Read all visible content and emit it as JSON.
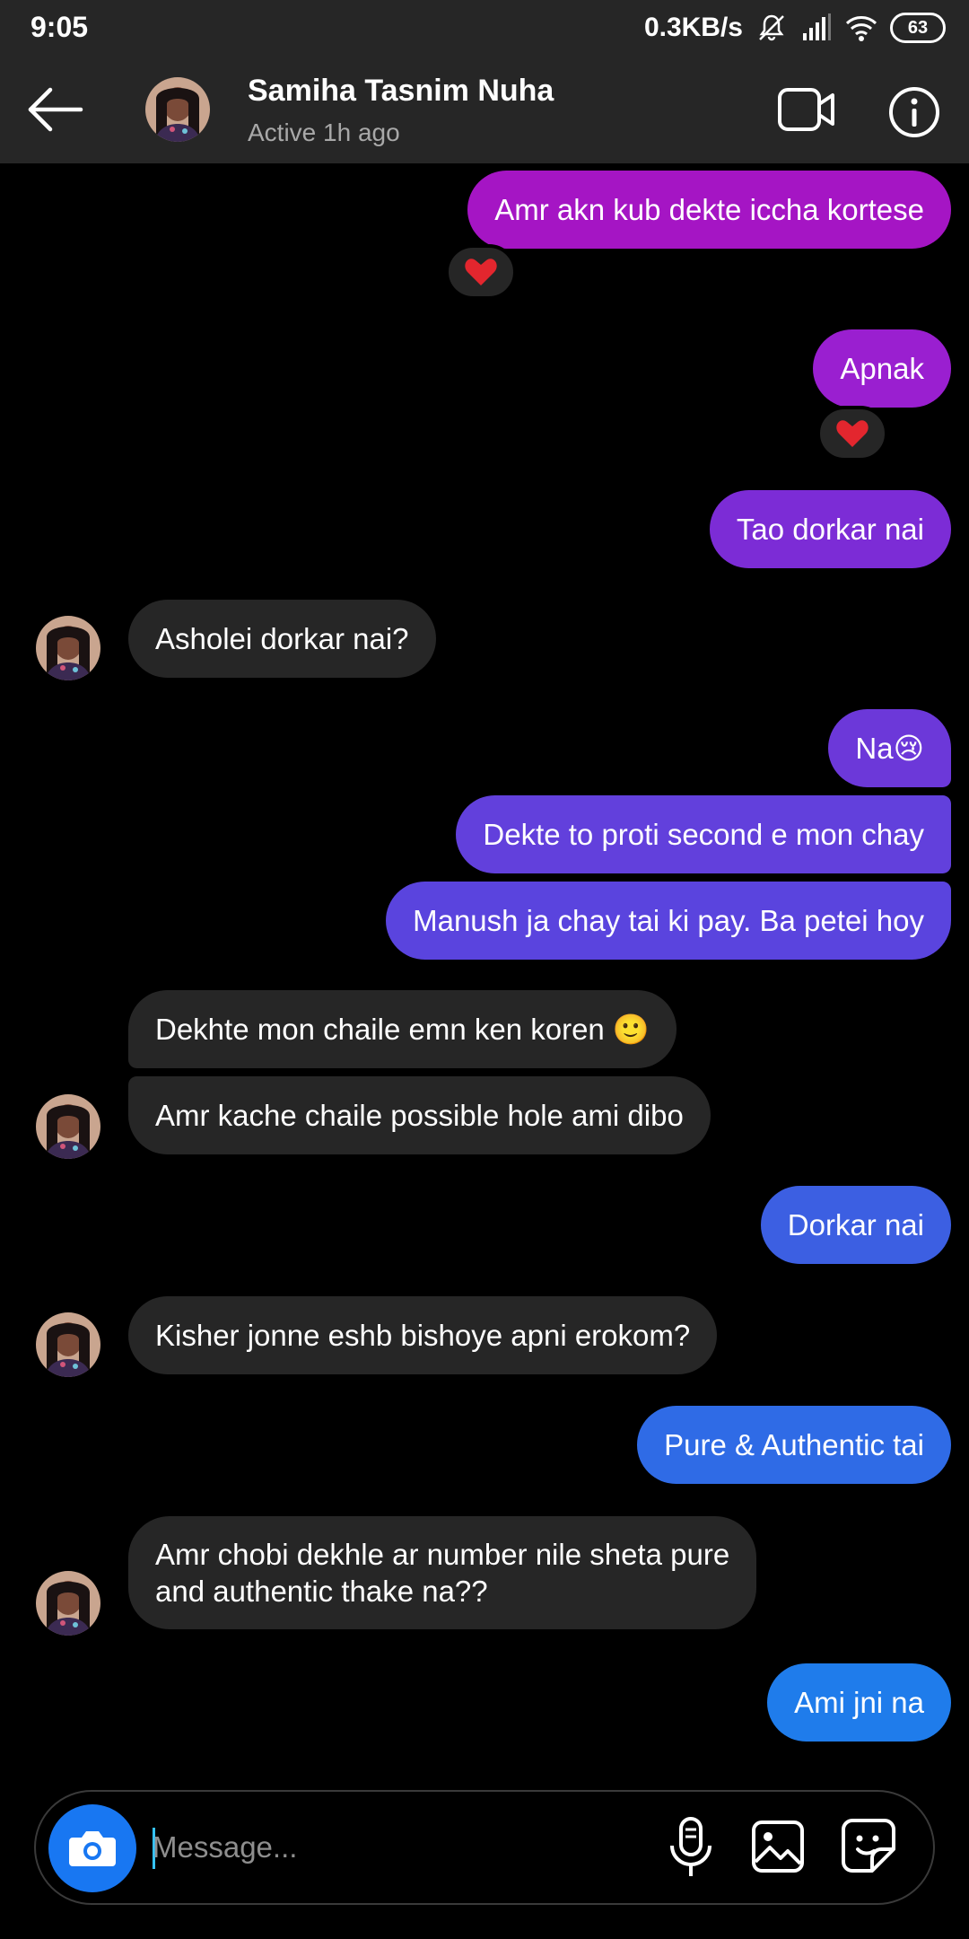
{
  "status_bar": {
    "time": "9:05",
    "network_speed": "0.3KB/s",
    "battery": "63"
  },
  "header": {
    "name": "Samiha Tasnim Nuha",
    "status": "Active 1h ago",
    "icons": [
      "back-arrow-icon",
      "video-call-icon",
      "info-icon"
    ]
  },
  "messages": [
    {
      "from": "me",
      "text": "Amr akn kub dekte iccha kortese",
      "color": "#a515c4",
      "reaction": "heart"
    },
    {
      "from": "me",
      "text": "Apnak",
      "color": "#9a1fd0",
      "reaction": "heart"
    },
    {
      "from": "me",
      "text": "Tao dorkar nai",
      "color": "#7c2cd6"
    },
    {
      "from": "them",
      "text": "Asholei dorkar nai?"
    },
    {
      "from": "me",
      "text": "Na😢",
      "color": "#6c38d9"
    },
    {
      "from": "me",
      "text": "Dekte to proti second e mon chay",
      "color": "#6240dc"
    },
    {
      "from": "me",
      "text": "Manush ja chay tai ki pay. Ba petei hoy",
      "color": "#5a44de"
    },
    {
      "from": "them",
      "text": "Dekhte mon chaile emn ken koren 🙂"
    },
    {
      "from": "them",
      "text": "Amr kache chaile possible hole ami dibo"
    },
    {
      "from": "me",
      "text": "Dorkar nai",
      "color": "#3c5fe2"
    },
    {
      "from": "them",
      "text": "Kisher jonne eshb bishoye apni erokom?"
    },
    {
      "from": "me",
      "text": "Pure & Authentic tai",
      "color": "#2f6be6"
    },
    {
      "from": "them",
      "text": "Amr chobi dekhle ar number nile sheta pure\nand authentic thake na??"
    },
    {
      "from": "me",
      "text": "Ami jni na",
      "color": "#1f7ceb"
    }
  ],
  "composer": {
    "placeholder": "Message..."
  },
  "colors": {
    "background": "#000000",
    "bar": "#262626",
    "incoming_bubble": "#262626",
    "accent": "#1877f2"
  }
}
